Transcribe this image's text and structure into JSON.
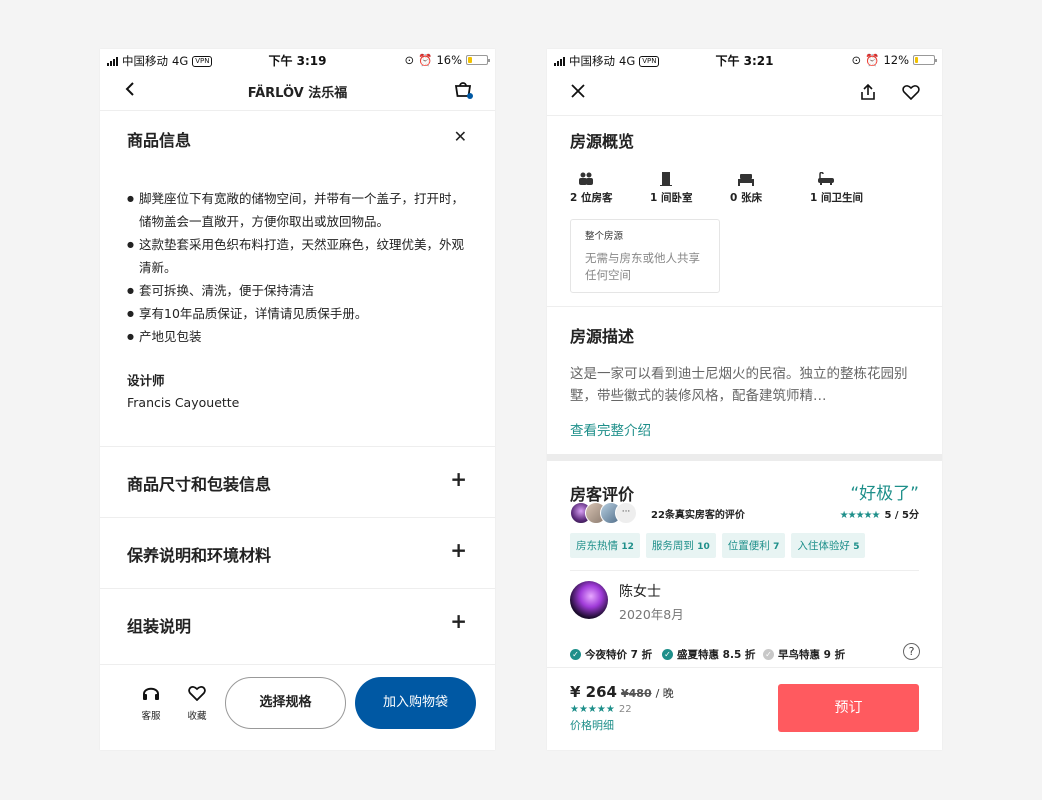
{
  "left": {
    "status": {
      "carrier": "中国移动",
      "network": "4G",
      "vpn": "VPN",
      "time": "下午 3:19",
      "battery": "16%"
    },
    "nav": {
      "title": "FÄRLÖV 法乐福"
    },
    "info": {
      "heading": "商品信息",
      "bullets": [
        "脚凳座位下有宽敞的储物空间，并带有一个盖子，打开时，储物盖会一直敞开，方便你取出或放回物品。",
        "这款垫套采用色织布料打造，天然亚麻色，纹理优美，外观清新。",
        "套可拆换、清洗，便于保持清洁",
        "享有10年品质保证，详情请见质保手册。",
        "产地见包装"
      ],
      "designer_label": "设计师",
      "designer_name": "Francis Cayouette"
    },
    "sections": [
      "商品尺寸和包装信息",
      "保养说明和环境材料",
      "组装说明"
    ],
    "bottom": {
      "service": "客服",
      "favorite": "收藏",
      "select": "选择规格",
      "add_to_cart": "加入购物袋"
    }
  },
  "right": {
    "status": {
      "carrier": "中国移动",
      "network": "4G",
      "vpn": "VPN",
      "time": "下午 3:21",
      "battery": "12%"
    },
    "overview": {
      "heading": "房源概览",
      "amenities": [
        "2 位房客",
        "1 间卧室",
        "0 张床",
        "1 间卫生间"
      ],
      "entire_title": "整个房源",
      "entire_desc": "无需与房东或他人共享任何空间"
    },
    "description": {
      "heading": "房源描述",
      "text": "这是一家可以看到迪士尼烟火的民宿。独立的整栋花园别墅，带些徽式的装修风格，配备建筑师精…",
      "more": "查看完整介绍"
    },
    "reviews": {
      "heading": "房客评价",
      "rating_word": "“好极了”",
      "more_dots": "···",
      "count_text": "22条真实房客的评价",
      "stars": "★★★★★",
      "score": "5 / 5分",
      "tags": [
        {
          "label": "房东热情",
          "count": "12"
        },
        {
          "label": "服务周到",
          "count": "10"
        },
        {
          "label": "位置便利",
          "count": "7"
        },
        {
          "label": "入住体验好",
          "count": "5"
        }
      ],
      "reviewer_name": "陈女士",
      "reviewer_date": "2020年8月"
    },
    "discounts": [
      "今夜特价 7 折",
      "盛夏特惠 8.5 折",
      "早鸟特惠 9 折"
    ],
    "price": {
      "current": "¥ 264",
      "original": "¥480",
      "unit": "/ 晚",
      "stars": "★★★★★",
      "review_count": "22",
      "details": "价格明细",
      "book": "预订"
    },
    "colors": {
      "teal": "#1e8f8a",
      "coral": "#ff5a5f",
      "ikea_blue": "#0058a3"
    }
  }
}
